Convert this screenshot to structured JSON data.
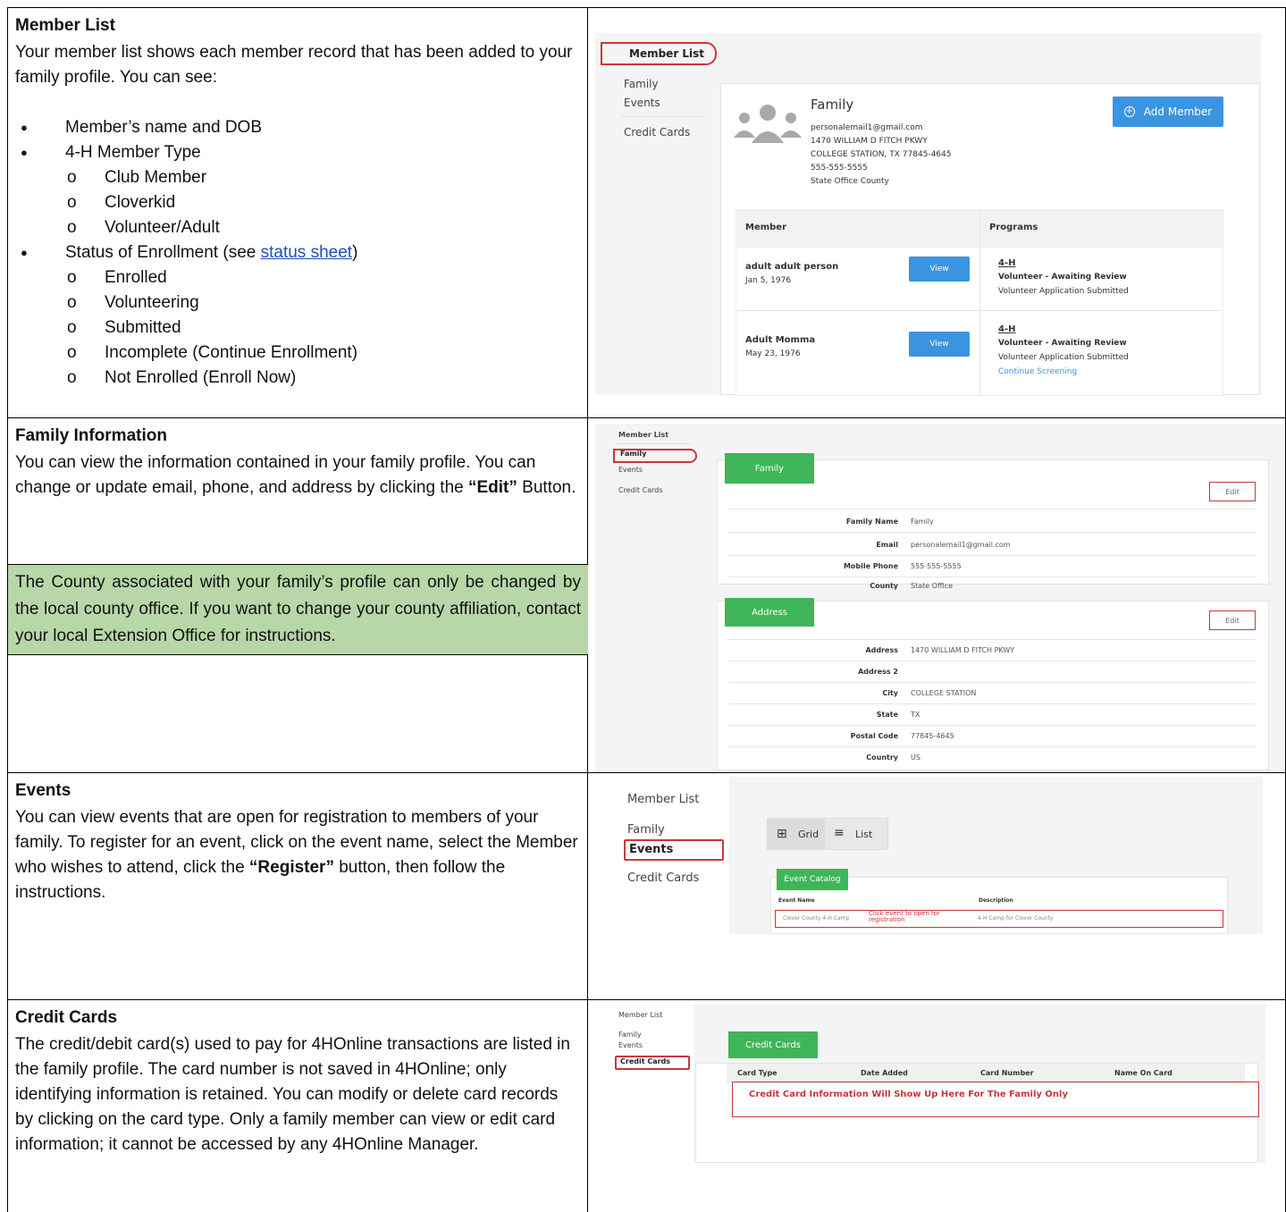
{
  "member_list": {
    "title": "Member List",
    "intro": "Your member list shows each member record that has been added to your family profile. You can see:",
    "bullets": [
      {
        "text": "Member’s name and DOB",
        "sub": []
      },
      {
        "text": "4-H Member Type",
        "sub": [
          "Club Member",
          "Cloverkid",
          "Volunteer/Adult"
        ]
      },
      {
        "text_before": "Status of Enrollment (see ",
        "link": "status sheet",
        "text_after": ")",
        "sub": [
          "Enrolled",
          "Volunteering",
          "Submitted",
          "Incomplete (Continue Enrollment)",
          "Not Enrolled (Enroll Now)"
        ]
      }
    ],
    "shot": {
      "nav": [
        "Member List",
        "Family",
        "Events",
        "Credit Cards"
      ],
      "family_name": "Family",
      "add_member": "Add Member",
      "email": "personalemail1@gmail.com",
      "address1": "1470 WILLIAM D FITCH PKWY",
      "address2": "COLLEGE STATION, TX 77845-4645",
      "phone": "555-555-5555",
      "county": "State Office County",
      "col_member": "Member",
      "col_programs": "Programs",
      "view_label": "View",
      "members": [
        {
          "name": "adult adult person",
          "dob": "Jan 5, 1976",
          "program": "4-H",
          "status": "Volunteer - Awaiting Review",
          "detail": "Volunteer Application Submitted",
          "link": ""
        },
        {
          "name": "Adult Momma",
          "dob": "May 23, 1976",
          "program": "4-H",
          "status": "Volunteer - Awaiting Review",
          "detail": "Volunteer Application Submitted",
          "link": "Continue Screening"
        }
      ]
    }
  },
  "family_info": {
    "title": "Family Information",
    "body_before": "You can view the information contained in your family profile. You can change or update email, phone, and address by clicking the ",
    "body_bold": "“Edit”",
    "body_after": " Button.",
    "note": "The County associated with your family’s profile can only be changed by the local county office. If you want to change your county affiliation, contact your local Extension Office for instructions.",
    "shot": {
      "nav": [
        "Member List",
        "Family",
        "Events",
        "Credit Cards"
      ],
      "family_tab": "Family",
      "address_tab": "Address",
      "edit": "Edit",
      "family_rows": [
        {
          "label": "Family Name",
          "value": "Family"
        },
        {
          "label": "Email",
          "value": "personalemail1@gmail.com"
        },
        {
          "label": "Mobile Phone",
          "value": "555-555-5555"
        },
        {
          "label": "County",
          "value": "State Office"
        }
      ],
      "address_rows": [
        {
          "label": "Address",
          "value": "1470 WILLIAM D FITCH PKWY"
        },
        {
          "label": "Address 2",
          "value": ""
        },
        {
          "label": "City",
          "value": "COLLEGE STATION"
        },
        {
          "label": "State",
          "value": "TX"
        },
        {
          "label": "Postal Code",
          "value": "77845-4645"
        },
        {
          "label": "Country",
          "value": "US"
        }
      ]
    }
  },
  "events": {
    "title": "Events",
    "body_before": "You can view events that are open for registration to members of your family. To register for an event, click on the event name, select the Member who wishes to attend, click the ",
    "body_bold": "“Register”",
    "body_after": " button, then follow the instructions.",
    "shot": {
      "nav": [
        "Member List",
        "Family",
        "Events",
        "Credit Cards"
      ],
      "grid": "Grid",
      "list": "List",
      "catalog": "Event Catalog",
      "col_name": "Event Name",
      "col_desc": "Description",
      "event_name": "Clover County 4-H Camp",
      "hint": "Click event to open for registration",
      "event_desc": "4-H Camp for Clover County"
    }
  },
  "credit_cards": {
    "title": "Credit Cards",
    "body": "The credit/debit card(s) used to pay for 4HOnline transactions are listed in the family profile. The card number is not saved in 4HOnline; only identifying information is retained. You can modify or delete card records by clicking on the card type. Only a family member can view or edit card information; it cannot be accessed by any 4HOnline Manager.",
    "shot": {
      "nav": [
        "Member List",
        "Family",
        "Events",
        "Credit Cards"
      ],
      "tab": "Credit Cards",
      "cols": [
        "Card Type",
        "Date Added",
        "Card Number",
        "Name On Card"
      ],
      "message": "Credit Card Information Will Show Up Here For The Family Only"
    }
  },
  "colors": {
    "accent_red": "#c9363e",
    "blue": "#3b94e0",
    "green": "#3fb55a",
    "note_green": "#b7d7a8"
  }
}
